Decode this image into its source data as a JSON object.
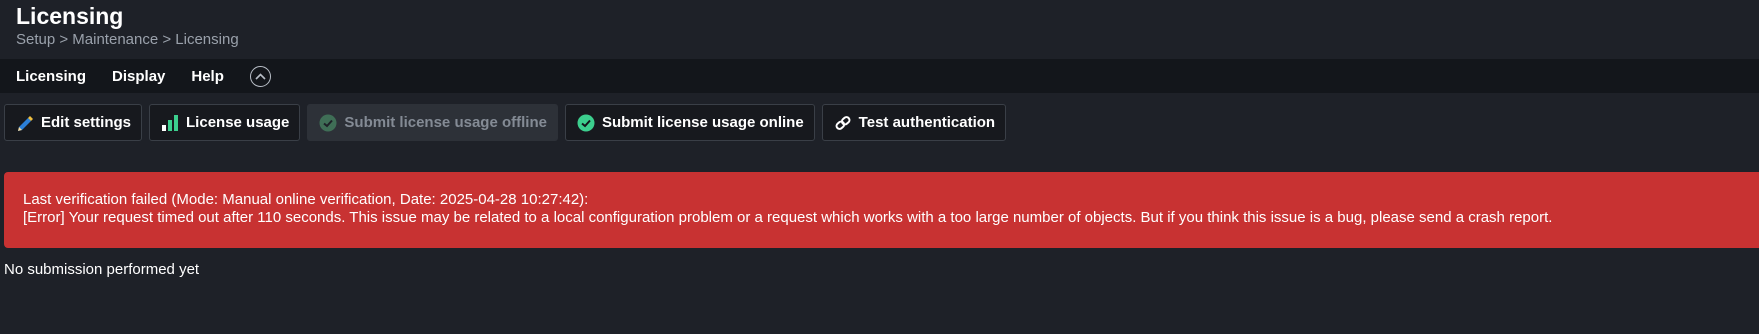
{
  "header": {
    "title": "Licensing",
    "breadcrumb": "Setup > Maintenance > Licensing"
  },
  "menubar": {
    "items": [
      "Licensing",
      "Display",
      "Help"
    ],
    "collapse_icon": "chevron-up-icon"
  },
  "toolbar": {
    "buttons": [
      {
        "label": "Edit settings",
        "icon": "pencil-icon",
        "enabled": true
      },
      {
        "label": "License usage",
        "icon": "bar-chart-icon",
        "enabled": true
      },
      {
        "label": "Submit license usage offline",
        "icon": "check-circle-icon",
        "enabled": false
      },
      {
        "label": "Submit license usage online",
        "icon": "check-circle-icon",
        "enabled": true
      },
      {
        "label": "Test authentication",
        "icon": "link-icon",
        "enabled": true
      }
    ]
  },
  "alert": {
    "line1": "Last verification failed (Mode: Manual online verification, Date: 2025-04-28 10:27:42):",
    "line2": "[Error] Your request timed out after 110 seconds. This issue may be related to a local configuration problem or a request which works with a too large number of objects. But if you think this issue is a bug, please send a crash report.",
    "color": "#c83232"
  },
  "status": {
    "text": "No submission performed yet"
  },
  "colors": {
    "background": "#1e2128",
    "menubar": "#13161b",
    "success_green": "#3ccf8e",
    "accent_blue": "#2b7fd8"
  }
}
